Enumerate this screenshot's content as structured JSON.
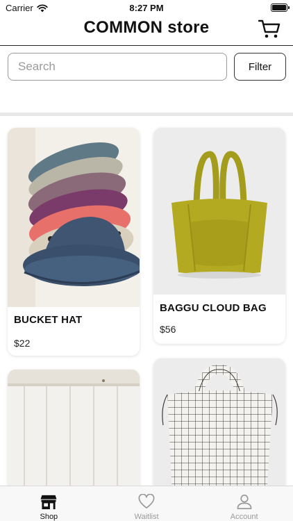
{
  "status_bar": {
    "carrier": "Carrier",
    "time": "8:27 PM"
  },
  "header": {
    "title": "COMMON store"
  },
  "search": {
    "placeholder": "Search",
    "value": ""
  },
  "filter": {
    "label": "Filter"
  },
  "products": [
    {
      "name": "BUCKET HAT",
      "price": "$22"
    },
    {
      "name": "BAGGU CLOUD BAG",
      "price": "$56"
    }
  ],
  "tabs": [
    {
      "label": "Shop",
      "icon": "shop-icon",
      "active": true
    },
    {
      "label": "Waitlist",
      "icon": "heart-icon",
      "active": false
    },
    {
      "label": "Account",
      "icon": "person-icon",
      "active": false
    }
  ]
}
